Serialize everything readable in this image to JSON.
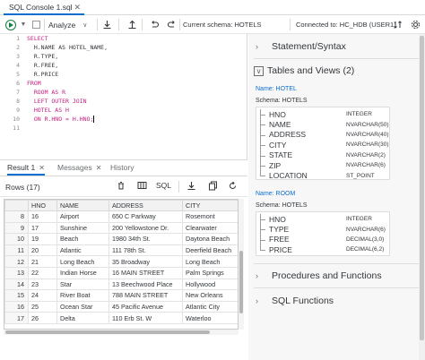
{
  "tab": {
    "title": "SQL Console 1.sql",
    "close": "✕"
  },
  "toolbar": {
    "analyze_label": "Analyze",
    "schema_text": "Current schema: HOTELS",
    "connection_text": "Connected to: HC_HDB (USER1)"
  },
  "editor": {
    "line_numbers": [
      "1",
      "2",
      "3",
      "4",
      "5",
      "6",
      "7",
      "8",
      "9",
      "10",
      "11"
    ],
    "lines": [
      {
        "kw": "SELECT",
        "rest": ""
      },
      {
        "kw": "",
        "rest": "  H.NAME AS HOTEL_NAME,"
      },
      {
        "kw": "",
        "rest": "  R.TYPE,"
      },
      {
        "kw": "",
        "rest": "  R.FREE,"
      },
      {
        "kw": "",
        "rest": "  R.PRICE"
      },
      {
        "kw": "FROM",
        "rest": ""
      },
      {
        "kw": "",
        "rest": "  ROOM AS R"
      },
      {
        "kw": "",
        "rest": "  LEFT OUTER JOIN"
      },
      {
        "kw": "",
        "rest": "  HOTEL AS H"
      },
      {
        "kw": "",
        "rest": "  ON R.HNO = H.HNO;"
      },
      {
        "kw": "",
        "rest": ""
      }
    ]
  },
  "results": {
    "tabs": [
      {
        "label": "Result 1",
        "close": "✕"
      },
      {
        "label": "Messages",
        "close": "✕"
      },
      {
        "label": "History",
        "close": ""
      }
    ],
    "rows_count": "Rows (17)",
    "sql_label": "SQL",
    "columns": [
      "",
      "HNO",
      "NAME",
      "ADDRESS",
      "CITY"
    ],
    "rows": [
      [
        "8",
        "16",
        "Airport",
        "650 C Parkway",
        "Rosemont"
      ],
      [
        "9",
        "17",
        "Sunshine",
        "200 Yellowstone Dr.",
        "Clearwater"
      ],
      [
        "10",
        "19",
        "Beach",
        "1980 34th St.",
        "Daytona Beach"
      ],
      [
        "11",
        "20",
        "Atlantic",
        "111 78th St.",
        "Deerfield Beach"
      ],
      [
        "12",
        "21",
        "Long Beach",
        "35 Broadway",
        "Long Beach"
      ],
      [
        "13",
        "22",
        "Indian Horse",
        "16 MAIN STREET",
        "Palm Springs"
      ],
      [
        "14",
        "23",
        "Star",
        "13 Beechwood Place",
        "Hollywood"
      ],
      [
        "15",
        "24",
        "River Boat",
        "788 MAIN STREET",
        "New Orleans"
      ],
      [
        "16",
        "25",
        "Ocean Star",
        "45 Pacific Avenue",
        "Atlantic City"
      ],
      [
        "17",
        "26",
        "Delta",
        "110 Erb St. W",
        "Waterloo"
      ]
    ]
  },
  "catalog": {
    "statement_syntax": "Statement/Syntax",
    "tables_views": "Tables and Views (2)",
    "procedures": "Procedures and Functions",
    "sql_functions": "SQL Functions",
    "objects": [
      {
        "name": "Name: HOTEL",
        "schema": "Schema: HOTELS",
        "columns": [
          {
            "name": "HNO",
            "type": "INTEGER"
          },
          {
            "name": "NAME",
            "type": "NVARCHAR(50)"
          },
          {
            "name": "ADDRESS",
            "type": "NVARCHAR(40)"
          },
          {
            "name": "CITY",
            "type": "NVARCHAR(30)"
          },
          {
            "name": "STATE",
            "type": "NVARCHAR(2)"
          },
          {
            "name": "ZIP",
            "type": "NVARCHAR(6)"
          },
          {
            "name": "LOCATION",
            "type": "ST_POINT"
          }
        ]
      },
      {
        "name": "Name: ROOM",
        "schema": "Schema: HOTELS",
        "columns": [
          {
            "name": "HNO",
            "type": "INTEGER"
          },
          {
            "name": "TYPE",
            "type": "NVARCHAR(6)"
          },
          {
            "name": "FREE",
            "type": "DECIMAL(3,0)"
          },
          {
            "name": "PRICE",
            "type": "DECIMAL(6,2)"
          }
        ]
      }
    ]
  }
}
